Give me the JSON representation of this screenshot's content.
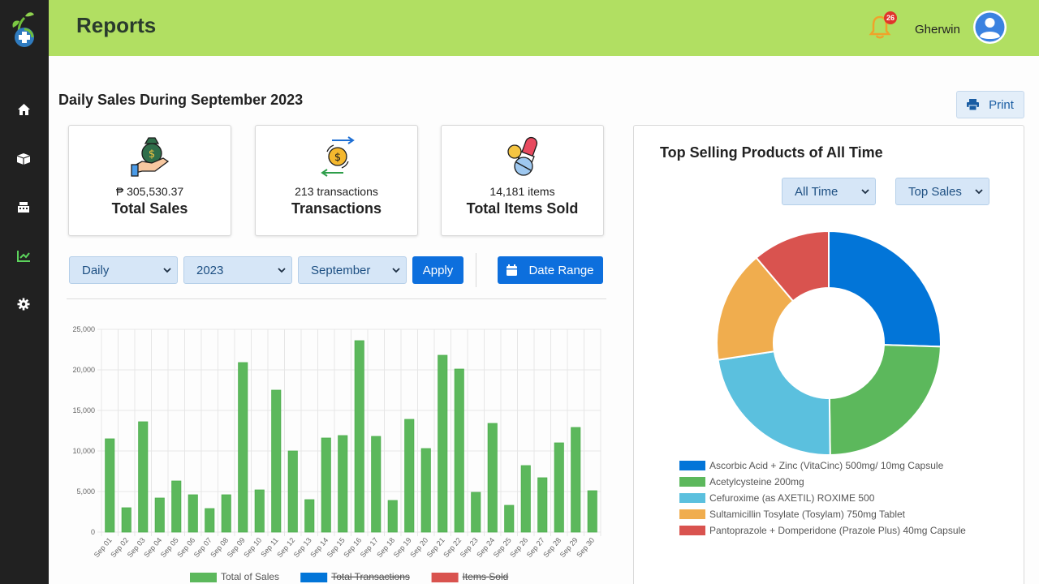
{
  "header": {
    "title": "Reports",
    "notification_count": "26",
    "user_name": "Gherwin"
  },
  "sidebar": {
    "items": [
      {
        "name": "home-icon",
        "active": false
      },
      {
        "name": "box-icon",
        "active": false
      },
      {
        "name": "register-icon",
        "active": false
      },
      {
        "name": "chart-icon",
        "active": true
      },
      {
        "name": "gear-icon",
        "active": false
      }
    ]
  },
  "main": {
    "section_title": "Daily Sales During September 2023",
    "print_label": "Print",
    "cards": [
      {
        "value": "₱ 305,530.37",
        "label": "Total Sales",
        "icon": "money-bag-icon"
      },
      {
        "value": "213 transactions",
        "label": "Transactions",
        "icon": "exchange-icon"
      },
      {
        "value": "14,181 items",
        "label": "Total Items Sold",
        "icon": "pills-icon"
      }
    ],
    "filters": {
      "period": "Daily",
      "year": "2023",
      "month": "September",
      "apply_label": "Apply",
      "date_range_label": "Date Range"
    }
  },
  "top_products": {
    "title": "Top Selling Products of All Time",
    "range_select": "All Time",
    "sort_select": "Top Sales"
  },
  "colors": {
    "accent": "#b1df62",
    "primary": "#0d6fdd",
    "green": "#5cb85c",
    "blue": "#0275d8",
    "lightblue": "#5bc0de",
    "orange": "#f0ad4e",
    "red": "#d9534f"
  },
  "chart_data": [
    {
      "type": "bar",
      "title": "",
      "xlabel": "",
      "ylabel": "",
      "ylim": [
        0,
        25000
      ],
      "yticks": [
        "0",
        "5,000",
        "10,000",
        "15,000",
        "20,000",
        "25,000"
      ],
      "categories": [
        "Sep 01",
        "Sep 02",
        "Sep 03",
        "Sep 04",
        "Sep 05",
        "Sep 06",
        "Sep 07",
        "Sep 08",
        "Sep 09",
        "Sep 10",
        "Sep 11",
        "Sep 12",
        "Sep 13",
        "Sep 14",
        "Sep 15",
        "Sep 16",
        "Sep 17",
        "Sep 18",
        "Sep 19",
        "Sep 20",
        "Sep 21",
        "Sep 22",
        "Sep 23",
        "Sep 24",
        "Sep 25",
        "Sep 26",
        "Sep 27",
        "Sep 28",
        "Sep 29",
        "Sep 30"
      ],
      "series": [
        {
          "name": "Total of Sales",
          "color": "#5cb85c",
          "hidden": false,
          "values": [
            11500,
            3000,
            13600,
            4200,
            6300,
            4600,
            2900,
            4600,
            20900,
            5200,
            17500,
            10000,
            4000,
            11600,
            11900,
            23600,
            11800,
            3900,
            13900,
            10300,
            21800,
            20100,
            4900,
            13400,
            3300,
            8200,
            6700,
            11000,
            12900,
            5100
          ]
        },
        {
          "name": "Total Transactions",
          "color": "#0275d8",
          "hidden": true,
          "values": []
        },
        {
          "name": "Items Sold",
          "color": "#d9534f",
          "hidden": true,
          "values": []
        }
      ],
      "grid": true,
      "legend": "bottom"
    },
    {
      "type": "pie",
      "donut": true,
      "title": "",
      "labels": [
        "Ascorbic Acid + Zinc (VitaCinc) 500mg/ 10mg Capsule",
        "Acetylcysteine 200mg",
        "Cefuroxime (as AXETIL) ROXIME 500",
        "Sultamicillin Tosylate (Tosylam) 750mg Tablet",
        "Pantoprazole + Domperidone (Prazole Plus) 40mg Capsule"
      ],
      "values": [
        25.5,
        24.3,
        22.8,
        16.2,
        11.2
      ],
      "colors": [
        "#0275d8",
        "#5cb85c",
        "#5bc0de",
        "#f0ad4e",
        "#d9534f"
      ],
      "legend": "bottom"
    }
  ]
}
